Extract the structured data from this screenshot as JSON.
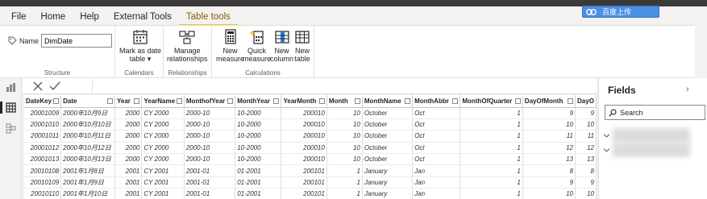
{
  "menu": {
    "tabs": [
      "File",
      "Home",
      "Help",
      "External Tools",
      "Table tools"
    ],
    "active_tab": "Table tools"
  },
  "cloud_badge": {
    "label": "百度上传"
  },
  "ribbon": {
    "structure": {
      "name_label": "Name",
      "name_value": "DimDate",
      "group_label": "Structure"
    },
    "calendars": {
      "mark_as_date_line1": "Mark as date",
      "mark_as_date_line2": "table ▾",
      "group_label": "Calendars"
    },
    "relationships": {
      "manage_line1": "Manage",
      "manage_line2": "relationships",
      "group_label": "Relationships"
    },
    "calculations": {
      "new_measure_line1": "New",
      "new_measure_line2": "measure",
      "quick_measure_line1": "Quick",
      "quick_measure_line2": "measure",
      "new_column_line1": "New",
      "new_column_line2": "column",
      "new_table_line1": "New",
      "new_table_line2": "table",
      "group_label": "Calculations"
    }
  },
  "table": {
    "columns": [
      "DateKey",
      "Date",
      "Year",
      "YearName",
      "MonthofYear",
      "MonthYear",
      "YearMonth",
      "Month",
      "MonthName",
      "MonthAbbr",
      "MonthOfQuarter",
      "DayOfMonth",
      "DayO"
    ],
    "rows": [
      [
        "20001009",
        "2000年10月9日",
        "2000",
        "CY 2000",
        "2000-10",
        "10-2000",
        "200010",
        "10",
        "October",
        "Oct",
        "1",
        "9",
        "9"
      ],
      [
        "20001010",
        "2000年10月10日",
        "2000",
        "CY 2000",
        "2000-10",
        "10-2000",
        "200010",
        "10",
        "October",
        "Oct",
        "1",
        "10",
        "10"
      ],
      [
        "20001011",
        "2000年10月11日",
        "2000",
        "CY 2000",
        "2000-10",
        "10-2000",
        "200010",
        "10",
        "October",
        "Oct",
        "1",
        "11",
        "11"
      ],
      [
        "20001012",
        "2000年10月12日",
        "2000",
        "CY 2000",
        "2000-10",
        "10-2000",
        "200010",
        "10",
        "October",
        "Oct",
        "1",
        "12",
        "12"
      ],
      [
        "20001013",
        "2000年10月13日",
        "2000",
        "CY 2000",
        "2000-10",
        "10-2000",
        "200010",
        "10",
        "October",
        "Oct",
        "1",
        "13",
        "13"
      ],
      [
        "20010108",
        "2001年1月8日",
        "2001",
        "CY 2001",
        "2001-01",
        "01-2001",
        "200101",
        "1",
        "January",
        "Jan",
        "1",
        "8",
        "8"
      ],
      [
        "20010109",
        "2001年1月9日",
        "2001",
        "CY 2001",
        "2001-01",
        "01-2001",
        "200101",
        "1",
        "January",
        "Jan",
        "1",
        "9",
        "9"
      ],
      [
        "20010110",
        "2001年1月10日",
        "2001",
        "CY 2001",
        "2001-01",
        "01-2001",
        "200101",
        "1",
        "January",
        "Jan",
        "1",
        "10",
        "10"
      ]
    ]
  },
  "fields_pane": {
    "title": "Fields",
    "search_placeholder": "Search"
  },
  "colors": {
    "accent": "#f2c811",
    "active_tab_text": "#8a5a00",
    "badge": "#4a90e2"
  }
}
